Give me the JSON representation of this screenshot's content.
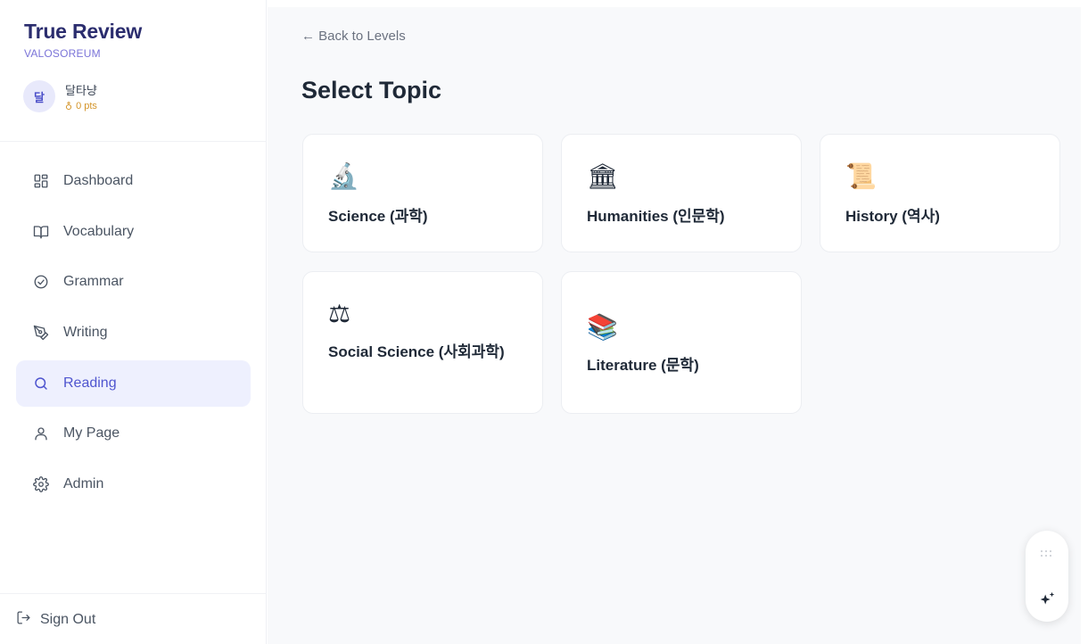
{
  "brand": {
    "title": "True Review",
    "subtitle": "VALOSOREUM"
  },
  "user": {
    "avatar_initial": "달",
    "name": "달타냥",
    "points_icon": "coin-icon",
    "points": "0 pts"
  },
  "nav": {
    "items": [
      {
        "label": "Dashboard",
        "icon": "dashboard-grid-icon",
        "active": false
      },
      {
        "label": "Vocabulary",
        "icon": "book-open-icon",
        "active": false
      },
      {
        "label": "Grammar",
        "icon": "check-circle-icon",
        "active": false
      },
      {
        "label": "Writing",
        "icon": "pen-tool-icon",
        "active": false
      },
      {
        "label": "Reading",
        "icon": "search-icon",
        "active": true
      },
      {
        "label": "My Page",
        "icon": "user-icon",
        "active": false
      },
      {
        "label": "Admin",
        "icon": "settings-gear-icon",
        "active": false
      }
    ],
    "signout": {
      "label": "Sign Out",
      "icon": "log-out-icon"
    }
  },
  "main": {
    "back_link": "← Back to Levels",
    "title": "Select Topic",
    "topics": [
      {
        "emoji": "🔬",
        "icon": "microscope-icon",
        "label": "Science (과학)"
      },
      {
        "emoji": "🏛",
        "icon": "classical-building-icon",
        "label": "Humanities (인문학)"
      },
      {
        "emoji": "📜",
        "icon": "scroll-icon",
        "label": "History (역사)"
      },
      {
        "emoji": "⚖",
        "icon": "balance-scale-icon",
        "label": "Social Science (사회과학)"
      },
      {
        "emoji": "📚",
        "icon": "books-icon",
        "label": "Literature (문학)"
      }
    ]
  },
  "widget": {
    "grip_icon": "drag-grip-icon",
    "action_icon": "sparkle-icon"
  },
  "colors": {
    "accent": "#4f55cf",
    "active_bg": "#eef0fe",
    "brand": "#2b2d6e",
    "points": "#d4952a"
  }
}
